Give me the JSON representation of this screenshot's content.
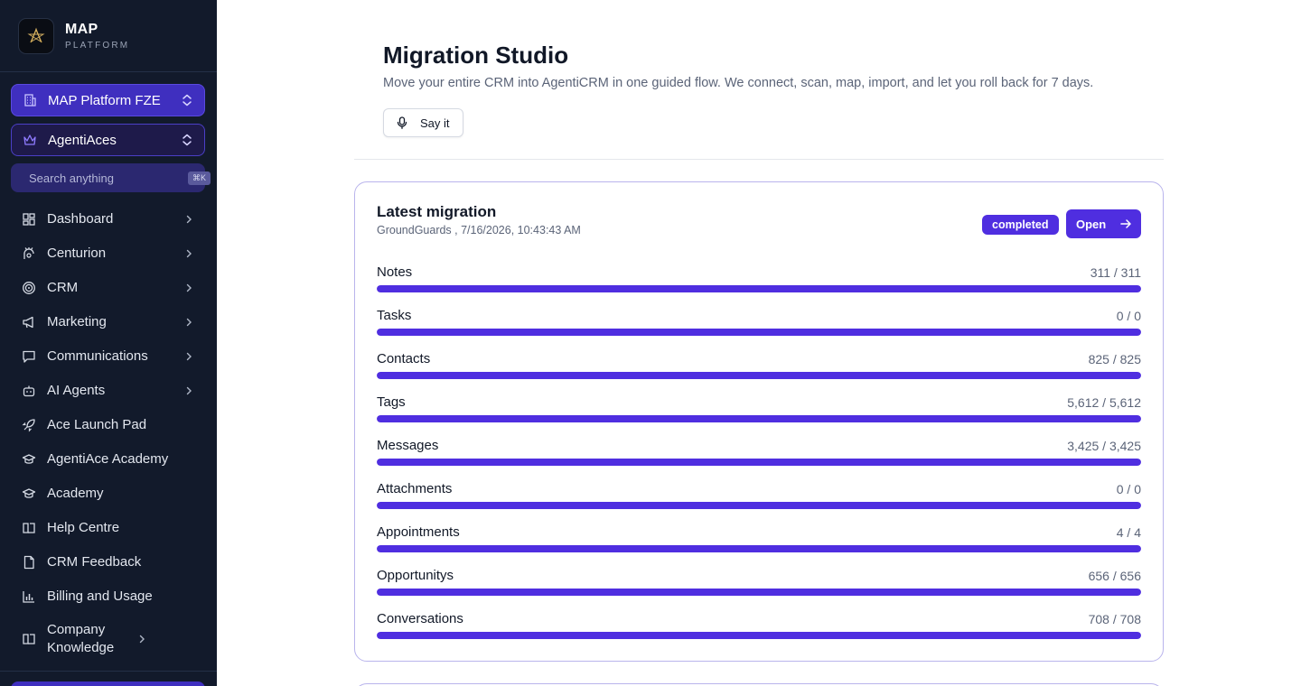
{
  "brand": {
    "name": "MAP",
    "subtitle": "PLATFORM"
  },
  "selectors": {
    "organization": "MAP Platform FZE",
    "workspace": "AgentiAces"
  },
  "search": {
    "placeholder": "Search anything",
    "shortcut": "⌘K"
  },
  "nav": {
    "items": [
      {
        "label": "Dashboard",
        "icon": "dashboard-grid-icon",
        "has_submenu": true
      },
      {
        "label": "Centurion",
        "icon": "centurion-icon",
        "has_submenu": true
      },
      {
        "label": "CRM",
        "icon": "target-icon",
        "has_submenu": true
      },
      {
        "label": "Marketing",
        "icon": "megaphone-icon",
        "has_submenu": true
      },
      {
        "label": "Communications",
        "icon": "chat-bubble-icon",
        "has_submenu": true
      },
      {
        "label": "AI Agents",
        "icon": "bot-icon",
        "has_submenu": true
      },
      {
        "label": "Ace Launch Pad",
        "icon": "rocket-icon",
        "has_submenu": false
      },
      {
        "label": "AgentiAce Academy",
        "icon": "graduation-cap-icon",
        "has_submenu": false
      },
      {
        "label": "Academy",
        "icon": "graduation-cap-icon",
        "has_submenu": false
      },
      {
        "label": "Help Centre",
        "icon": "book-open-icon",
        "has_submenu": false
      },
      {
        "label": "CRM Feedback",
        "icon": "file-icon",
        "has_submenu": false
      },
      {
        "label": "Billing and Usage",
        "icon": "bar-chart-icon",
        "has_submenu": false
      },
      {
        "label": "Company Knowledge",
        "icon": "book-open-icon",
        "has_submenu": true
      }
    ]
  },
  "page": {
    "title": "Migration Studio",
    "subtitle": "Move your entire CRM into AgentiCRM in one guided flow. We connect, scan, map, import, and let you roll back for 7 days.",
    "say_button": "Say it"
  },
  "migration": {
    "title": "Latest migration",
    "meta": "GroundGuards , 7/16/2026, 10:43:43 AM",
    "status": "completed",
    "open_button": "Open",
    "rows": [
      {
        "label": "Notes",
        "count": "311 / 311",
        "progress": 1.0
      },
      {
        "label": "Tasks",
        "count": "0 / 0",
        "progress": 1.0
      },
      {
        "label": "Contacts",
        "count": "825 / 825",
        "progress": 1.0
      },
      {
        "label": "Tags",
        "count": "5,612 / 5,612",
        "progress": 1.0
      },
      {
        "label": "Messages",
        "count": "3,425 / 3,425",
        "progress": 1.0
      },
      {
        "label": "Attachments",
        "count": "0 / 0",
        "progress": 1.0
      },
      {
        "label": "Appointments",
        "count": "4 / 4",
        "progress": 1.0
      },
      {
        "label": "Opportunitys",
        "count": "656 / 656",
        "progress": 1.0
      },
      {
        "label": "Conversations",
        "count": "708 / 708",
        "progress": 1.0
      }
    ]
  },
  "colors": {
    "sidebar_bg": "#121a2b",
    "accent": "#4f2ee0",
    "progress_track": "#e4e1fb",
    "card_border": "#b9b4ec"
  }
}
